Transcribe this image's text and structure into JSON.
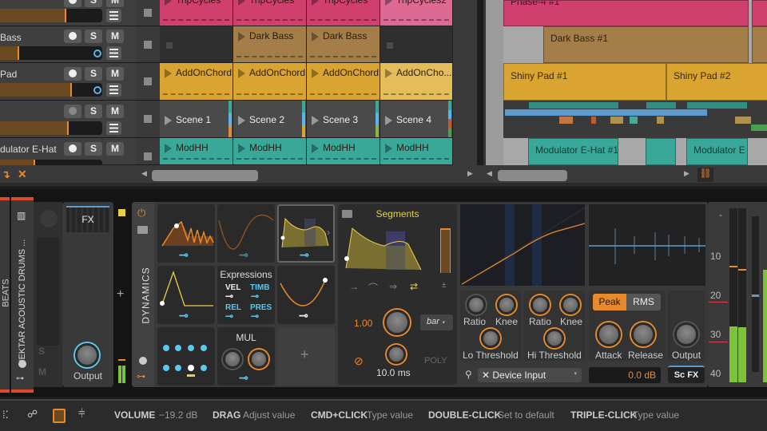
{
  "tracks": [
    {
      "name": "",
      "clips": [
        "TripCycles",
        "TripCycles",
        "TripCycles",
        "TripCycles2"
      ],
      "color": "#d0406f"
    },
    {
      "name": "Bass",
      "clips": [
        "",
        "Dark Bass",
        "Dark Bass",
        ""
      ],
      "color": "#a47e48"
    },
    {
      "name": "Pad",
      "clips": [
        "AddOnChord",
        "AddOnChord",
        "AddOnChord",
        "AddOnCho..."
      ],
      "color": "#d9a530"
    },
    {
      "name": "",
      "clips": [
        "Scene 1",
        "Scene 2",
        "Scene 3",
        "Scene 4"
      ],
      "color": "#4a4a4a"
    },
    {
      "name": "dulator E-Hat",
      "clips": [
        "ModHH",
        "ModHH",
        "ModHH",
        "ModHH"
      ],
      "color": "#3aa898"
    }
  ],
  "track_buttons": {
    "solo": "S",
    "mute": "M"
  },
  "arranger": {
    "clips": [
      "Phase-4 #1",
      "Dark Bass #1",
      "Shiny Pad #1",
      "Shiny Pad #2",
      "Modulator E-Hat #1",
      "Modulator E"
    ]
  },
  "device_panel": {
    "track_label": "NEKTAR ACOUSTIC DRUMS ...",
    "side_label": "BEATS",
    "fx_label": "FX",
    "output_label": "Output",
    "device_name": "DYNAMICS",
    "expressions": {
      "title": "Expressions",
      "vel": "VEL",
      "timb": "TIMB",
      "rel": "REL",
      "pres": "PRES"
    },
    "mul_label": "MUL",
    "segments": {
      "title": "Segments",
      "value": "1.00",
      "unit_select": "bar",
      "time": "10.0 ms",
      "poly": "POLY",
      "plusminus": "±"
    },
    "knobs": {
      "ratio": "Ratio",
      "knee": "Knee",
      "lo_threshold": "Lo Threshold",
      "hi_threshold": "Hi Threshold",
      "attack": "Attack",
      "release": "Release",
      "output": "Output"
    },
    "detector": {
      "peak": "Peak",
      "rms": "RMS",
      "active": "Peak"
    },
    "sidechain": {
      "input": "Device Input",
      "gain": "0.0 dB",
      "sc_fx": "Sc FX"
    },
    "meter_scale": [
      "10",
      "20",
      "30",
      "40"
    ]
  },
  "status_bar": {
    "param": "VOLUME",
    "value": "−19.2 dB",
    "hints": [
      {
        "key": "DRAG",
        "action": "Adjust value"
      },
      {
        "key": "CMD+CLICK",
        "action": "Type value"
      },
      {
        "key": "DOUBLE-CLICK",
        "action": "Set to default"
      },
      {
        "key": "TRIPLE-CLICK",
        "action": "Type value"
      }
    ]
  },
  "colors": {
    "accent": "#e8892e",
    "mod_blue": "#5ac8f0",
    "segments_yellow": "#e6cf4a",
    "meter_green": "#7dc23a"
  }
}
